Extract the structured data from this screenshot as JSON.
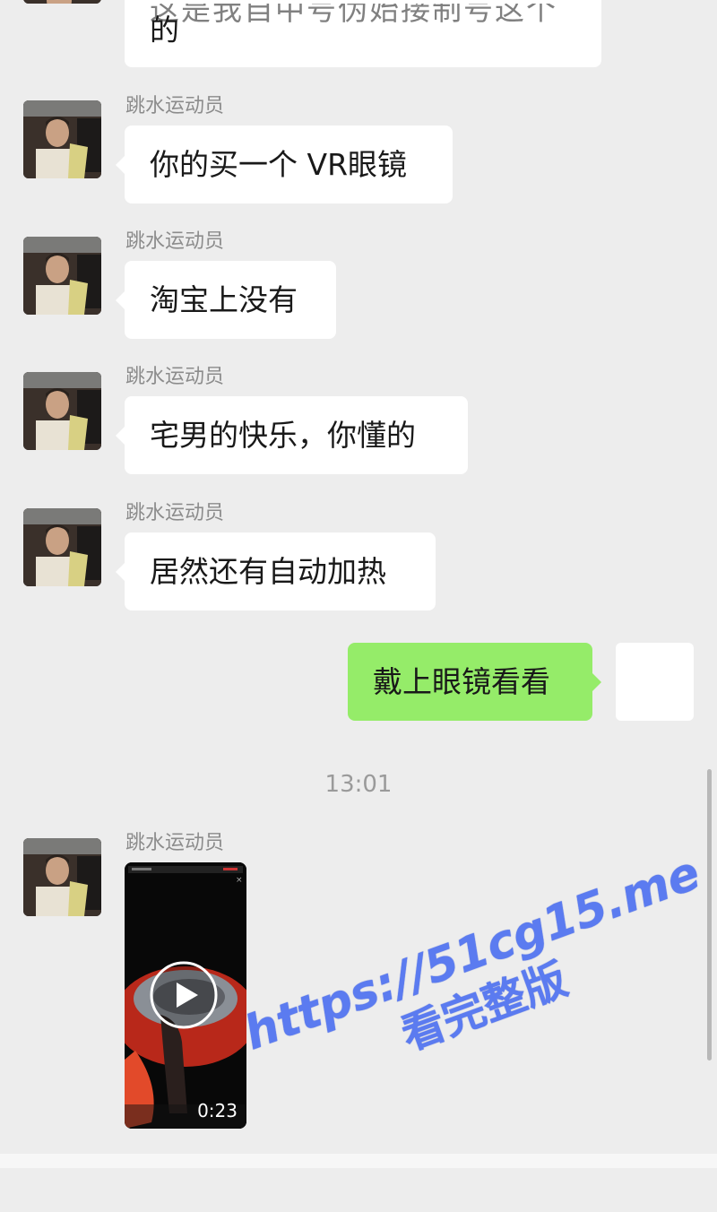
{
  "sender_name": "跳水运动员",
  "top_partial_message": {
    "line1": "这是我自中号伪始接制号这个",
    "line2": "的"
  },
  "messages": [
    {
      "sender": "跳水运动员",
      "text": "你的买一个 VR眼镜"
    },
    {
      "sender": "跳水运动员",
      "text": "淘宝上没有"
    },
    {
      "sender": "跳水运动员",
      "text": "宅男的快乐，你懂的"
    },
    {
      "sender": "跳水运动员",
      "text": "居然还有自动加热"
    }
  ],
  "outgoing_message": {
    "text": "戴上眼镜看看"
  },
  "timestamp": "13:01",
  "video_message": {
    "sender": "跳水运动员",
    "duration": "0:23"
  },
  "watermark": {
    "url": "https://51cg15.me",
    "text": "看完整版"
  },
  "colors": {
    "background": "#ededed",
    "incoming_bubble": "#ffffff",
    "outgoing_bubble": "#95ec69",
    "watermark": "#5b7bf0"
  }
}
